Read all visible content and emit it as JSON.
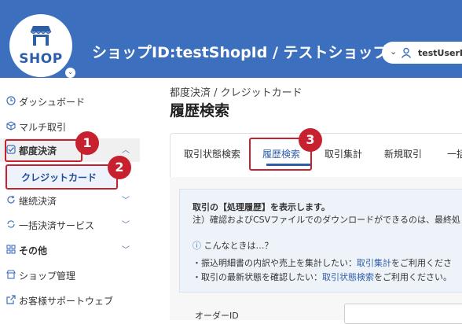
{
  "header": {
    "logo_text": "SHOP",
    "shop_title": "ショップID:testShopId / テストショップ",
    "user_name": "testUserId"
  },
  "sidebar": {
    "items": [
      {
        "label": "ダッシュボード"
      },
      {
        "label": "マルチ取引"
      },
      {
        "label": "都度決済"
      },
      {
        "label": "継続決済"
      },
      {
        "label": "一括決済サービス"
      },
      {
        "label": "その他"
      },
      {
        "label": "ショップ管理"
      },
      {
        "label": "お客様サポートウェブ"
      }
    ],
    "sub_item": "クレジットカード"
  },
  "annotations": {
    "badge1": "1",
    "badge2": "2",
    "badge3": "3"
  },
  "main": {
    "breadcrumb": "都度決済 / クレジットカード",
    "title": "履歴検索",
    "tabs": [
      {
        "label": "取引状態検索"
      },
      {
        "label": "履歴検索"
      },
      {
        "label": "取引集計"
      },
      {
        "label": "新規取引"
      },
      {
        "label": "一括"
      }
    ],
    "info": {
      "line1": "取引の【処理履歴】を表示します。",
      "line2": "注）確認およびCSVファイルでのダウンロードができるのは、最終処",
      "help_heading": "こんなときは…？",
      "bullet1_prefix": "・振込明細書の内訳や売上を集計したい：",
      "bullet1_link": "取引集計",
      "bullet1_suffix": "をご利用くださ",
      "bullet2_prefix": "・取引の最新状態を確認したい：",
      "bullet2_link": "取引状態検索",
      "bullet2_suffix": "をご利用ください。"
    },
    "order_id_label": "オーダーID"
  },
  "colors": {
    "header_blue": "#3c6fbe",
    "accent_red": "#c7202f",
    "link_blue": "#2f5ea9"
  }
}
